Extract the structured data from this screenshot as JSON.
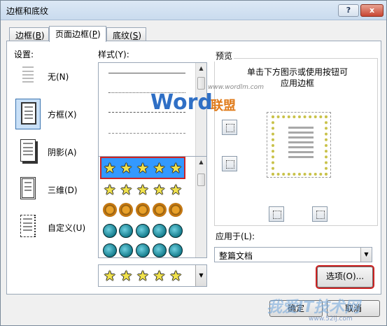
{
  "window": {
    "title": "边框和底纹",
    "help": "?",
    "close": "x"
  },
  "tabs": [
    {
      "label": "边框(",
      "key": "B",
      "tail": ")"
    },
    {
      "label": "页面边框(",
      "key": "P",
      "tail": ")"
    },
    {
      "label": "底纹(",
      "key": "S",
      "tail": ")"
    }
  ],
  "settings": {
    "label": "设置:",
    "items": [
      {
        "label": "无(N)"
      },
      {
        "label": "方框(X)"
      },
      {
        "label": "阴影(A)"
      },
      {
        "label": "三维(D)"
      },
      {
        "label": "自定义(U)"
      }
    ]
  },
  "style": {
    "label": "样式(Y):"
  },
  "preview": {
    "label": "预览",
    "instructions_line1": "单击下方图示或使用按钮可",
    "instructions_line2": "应用边框"
  },
  "apply_to": {
    "label": "应用于(L):",
    "value": "整篇文档"
  },
  "options_button": "选项(O)...",
  "ok_button": "确定",
  "cancel_button": "取消",
  "watermark": {
    "brand": "Word",
    "brand_cn": "联盟",
    "url": "www.wordlm.com",
    "site": "我爱IT技术网",
    "site_url": "www.52ij.com"
  },
  "colors": {
    "accent": "#3399ff",
    "highlight": "#cc2222"
  }
}
